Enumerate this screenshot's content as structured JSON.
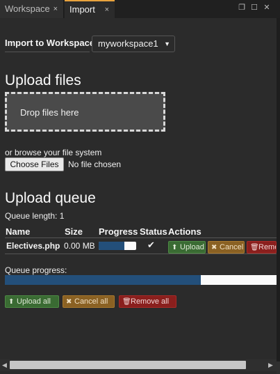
{
  "tabs": [
    {
      "label": "Workspace",
      "active": false
    },
    {
      "label": "Import",
      "active": true
    }
  ],
  "workspace": {
    "label": "Import to Workspace",
    "selected": "myworkspace1"
  },
  "upload": {
    "heading": "Upload files",
    "dropzone_text": "Drop files here",
    "browse_text": "or browse your file system",
    "choose_button": "Choose Files",
    "no_file": "No file chosen"
  },
  "queue": {
    "heading": "Upload queue",
    "length_text": "Queue length: 1",
    "columns": [
      "Name",
      "Size",
      "Progress",
      "Status",
      "Actions"
    ],
    "items": [
      {
        "name": "Electives.php",
        "size": "0.00 MB",
        "progress": 0.68,
        "status": "check",
        "actions": {
          "upload": "Upload",
          "cancel": "Cancel",
          "remove": "Remove"
        }
      }
    ],
    "progress_label": "Queue progress:",
    "progress": 0.72,
    "buttons": {
      "upload_all": "Upload all",
      "cancel_all": "Cancel all",
      "remove_all": "Remove all"
    }
  },
  "colors": {
    "accent": "#e8a33d",
    "progress_fill": "#234f7a",
    "success": "#3a6b33",
    "warning": "#8a6123",
    "danger": "#8a1f1d"
  },
  "icons": {
    "tab_close": "×",
    "restore": "❐",
    "maximize": "☐",
    "close": "✕",
    "caret": "▼",
    "check": "✔",
    "upload": "⬆",
    "cancel": "✖",
    "trash": "🗑"
  }
}
